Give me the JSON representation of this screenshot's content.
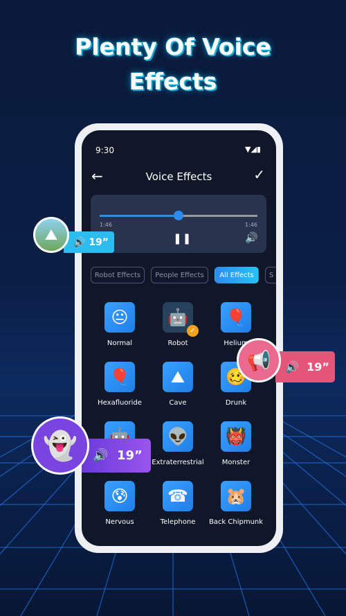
{
  "headline": [
    "Plenty Of Voice",
    "Effects"
  ],
  "status": {
    "time": "9:30"
  },
  "header": {
    "title": "Voice Effects",
    "back_icon": "arrow-left-icon",
    "confirm_icon": "check-icon"
  },
  "player": {
    "progress_percent": 50,
    "elapsed": "1:46",
    "total": "1:46"
  },
  "filters": [
    {
      "label": "Robot Effects"
    },
    {
      "label": "People Effects"
    },
    {
      "label": "All Effects",
      "active": true
    },
    {
      "label": "S"
    }
  ],
  "effects": [
    {
      "label": "Normal",
      "icon": "😐"
    },
    {
      "label": "Robot",
      "icon": "🤖",
      "selected": true
    },
    {
      "label": "Helium",
      "icon": "🎈"
    },
    {
      "label": "Hexafluoride",
      "icon": "🎈"
    },
    {
      "label": "Cave",
      "icon": "⛰"
    },
    {
      "label": "Drunk",
      "icon": "🥴"
    },
    {
      "label": "",
      "icon": "🤖"
    },
    {
      "label": "Extraterrestrial",
      "icon": "👽"
    },
    {
      "label": "Monster",
      "icon": "👹"
    },
    {
      "label": "Nervous",
      "icon": "😰"
    },
    {
      "label": "Telephone",
      "icon": "☎"
    },
    {
      "label": "Back Chipmunk",
      "icon": "🐹"
    }
  ],
  "badges": [
    {
      "duration": "19”",
      "color": "#2bbdf0"
    },
    {
      "duration": "19”",
      "color": "#e5557a"
    },
    {
      "duration": "19”",
      "color": "#8b4de8"
    }
  ]
}
